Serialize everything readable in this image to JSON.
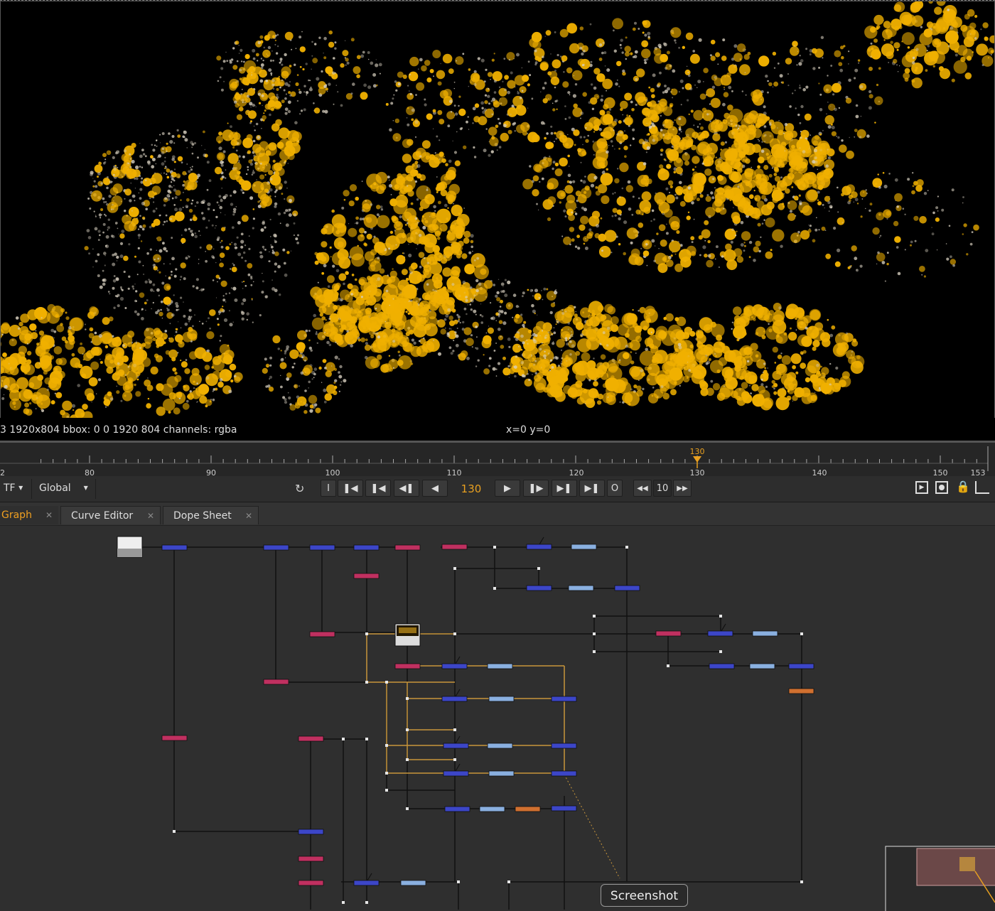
{
  "viewer": {
    "format_info": "3 1920x804  bbox: 0 0 1920 804 channels: rgba",
    "coords": "x=0 y=0"
  },
  "timeline": {
    "tick_labels": [
      "2",
      "80",
      "90",
      "100",
      "110",
      "120",
      "130",
      "140",
      "150",
      "153"
    ],
    "current_frame_label": "130",
    "range": [
      79,
      153
    ],
    "current_frame": 130
  },
  "transport": {
    "tf_label": "TF",
    "global_label": "Global",
    "in_label": "I",
    "out_label": "O",
    "frame": "130",
    "increment": "10"
  },
  "tabs": [
    {
      "label": "Graph",
      "active": true
    },
    {
      "label": "Curve Editor",
      "active": false
    },
    {
      "label": "Dope Sheet",
      "active": false
    }
  ],
  "tooltip": "Screenshot",
  "colors": {
    "accent_orange": "#e8a020",
    "particle_gold": "#f0b000",
    "merge_node": "#3c46c8",
    "grade_node": "#c03060",
    "transform_node": "#8ab0e0",
    "write_node": "#d07030",
    "wire": "#111111",
    "selected_wire": "#c8963c"
  },
  "icons": [
    "tf-dropdown-icon",
    "global-dropdown-icon",
    "loop-icon",
    "first-frame-icon",
    "prev-keyframe-icon",
    "step-back-icon",
    "play-backward-icon",
    "play-forward-icon",
    "step-forward-icon",
    "next-keyframe-icon",
    "last-frame-icon",
    "rewind-increment-icon",
    "forward-increment-icon",
    "viewer-play-icon",
    "viewer-record-icon",
    "lock-icon",
    "chart-icon",
    "close-icon"
  ]
}
